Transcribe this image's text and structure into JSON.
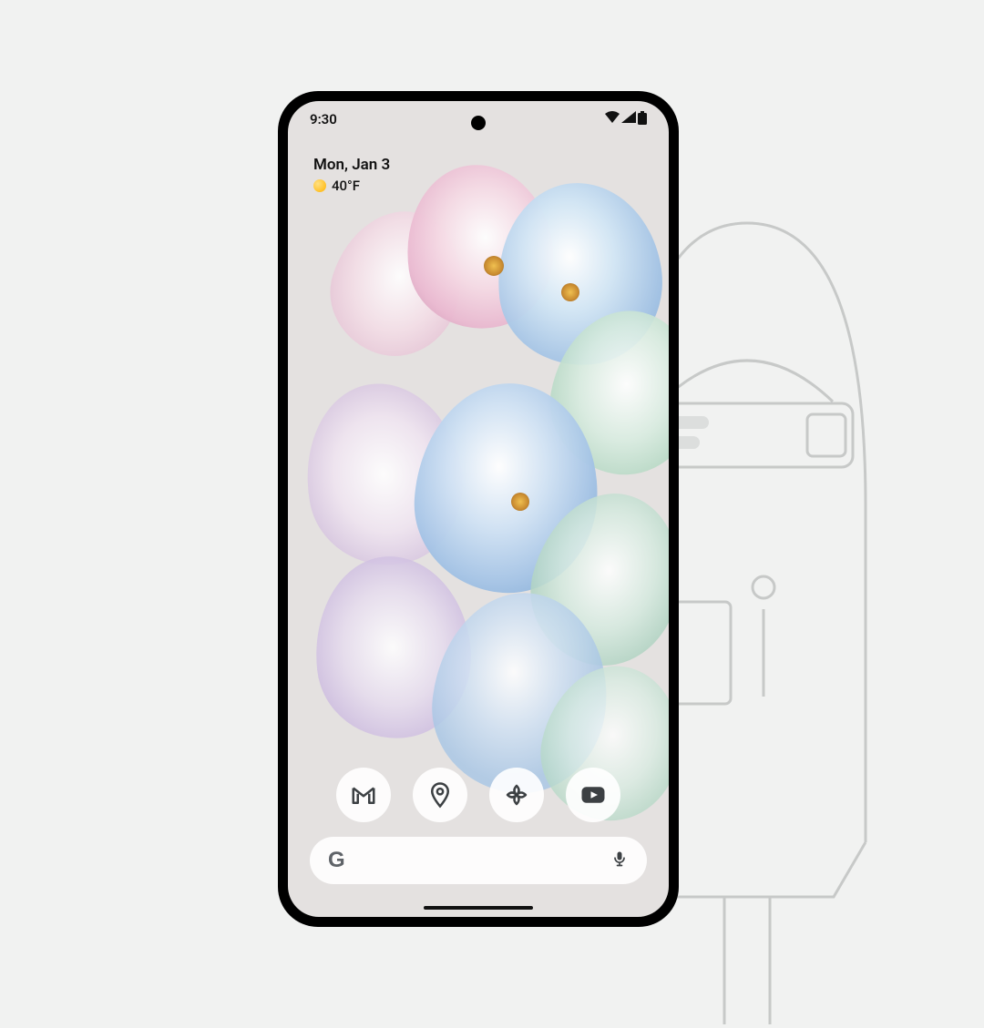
{
  "statusbar": {
    "time": "9:30"
  },
  "ataglance": {
    "date": "Mon, Jan 3",
    "temperature": "40°F"
  },
  "dock": {
    "apps": [
      {
        "name": "gmail"
      },
      {
        "name": "maps"
      },
      {
        "name": "photos"
      },
      {
        "name": "youtube"
      }
    ]
  },
  "search": {
    "logo": "G"
  }
}
